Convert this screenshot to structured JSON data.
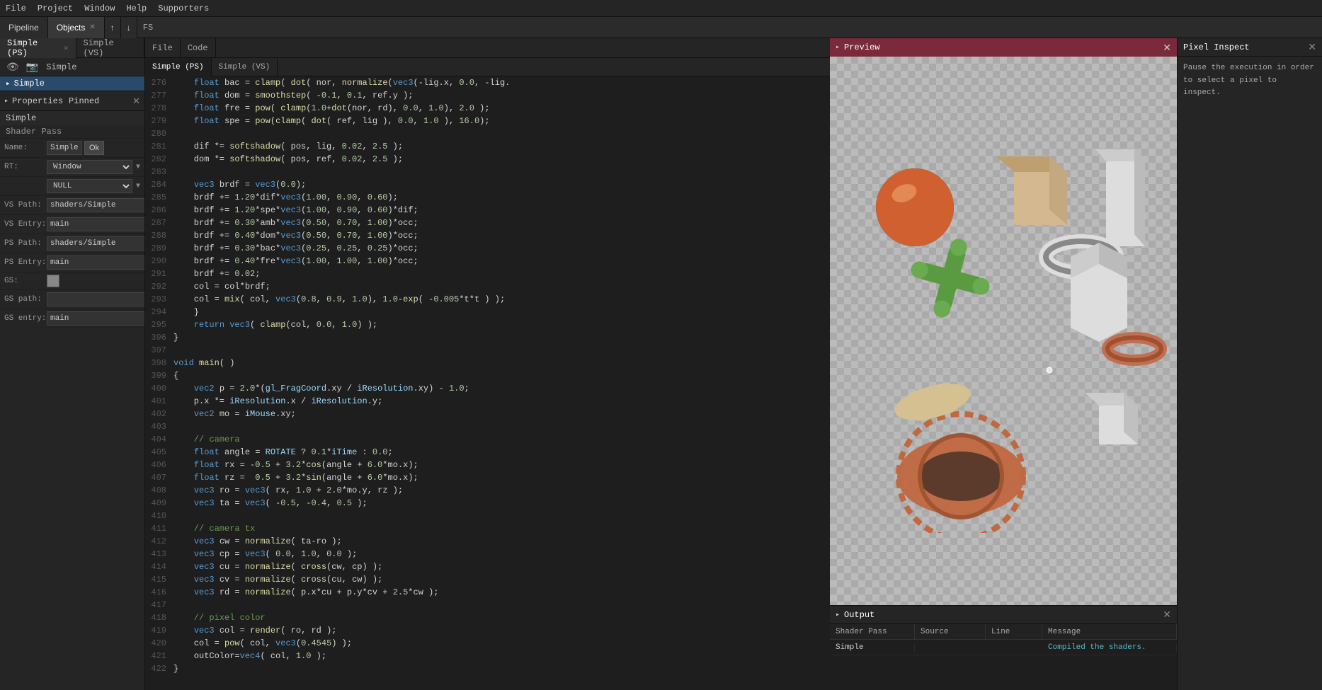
{
  "menuBar": {
    "items": [
      "File",
      "Project",
      "Window",
      "Help",
      "Supporters"
    ]
  },
  "toolbar": {
    "tabs": [
      {
        "label": "Pipeline",
        "active": false
      },
      {
        "label": "Objects",
        "active": true,
        "closable": true
      }
    ],
    "arrows": [
      "↑",
      "↓"
    ],
    "fsLabel": "FS"
  },
  "leftPanel": {
    "tabs": [
      {
        "label": "Simple (PS)",
        "active": true,
        "modified": true,
        "closable": true
      },
      {
        "label": "Simple (VS)",
        "active": false,
        "closable": false
      }
    ],
    "treeItems": [
      {
        "label": "Simple",
        "selected": true,
        "indent": 0
      }
    ]
  },
  "propertiesPanel": {
    "headerLabel": "Properties",
    "pinnedLabel": "Pinned",
    "sectionLabel": "Simple",
    "subsectionLabel": "Shader Pass",
    "fields": {
      "name": {
        "label": "Name:",
        "value": "Simple",
        "btnLabel": "Ok"
      },
      "rt": {
        "label": "RT:",
        "value": "Window",
        "dropdown": true
      },
      "rtNull": {
        "label": "",
        "value": "NULL",
        "dropdown": true
      },
      "vsPath": {
        "label": "VS Path:",
        "value": "shaders/Simple",
        "browseable": true
      },
      "vsEntry": {
        "label": "VS Entry:",
        "value": "main"
      },
      "psPath": {
        "label": "PS Path:",
        "value": "shaders/Simple",
        "browseable": true
      },
      "psEntry": {
        "label": "PS Entry:",
        "value": "main"
      },
      "gs": {
        "label": "GS:",
        "value": ""
      },
      "gsPath": {
        "label": "GS path:",
        "value": "",
        "browseable": true
      },
      "gsEntry": {
        "label": "GS entry:",
        "value": "main"
      }
    }
  },
  "codeEditor": {
    "codeTabs": [
      {
        "label": "File",
        "active": false
      },
      {
        "label": "Code",
        "active": false
      }
    ],
    "fileTabs": [
      {
        "label": "Simple (PS)",
        "active": true,
        "modified": true
      },
      {
        "label": "Simple (VS)",
        "active": false
      }
    ],
    "lines": [
      {
        "num": 276,
        "code": "    float bac = clamp( dot( nor, normalize(vec3(-lig.x, 0.0, -lig."
      },
      {
        "num": 277,
        "code": "    float dom = smoothstep( -0.1, 0.1, ref.y );"
      },
      {
        "num": 278,
        "code": "    float fre = pow( clamp(1.0+dot(nor, rd), 0.0, 1.0), 2.0 );"
      },
      {
        "num": 279,
        "code": "    float spe = pow(clamp( dot( ref, lig ), 0.0, 1.0 ), 16.0);"
      },
      {
        "num": 280,
        "code": ""
      },
      {
        "num": 281,
        "code": "    dif *= softshadow( pos, lig, 0.02, 2.5 );"
      },
      {
        "num": 282,
        "code": "    dom *= softshadow( pos, ref, 0.02, 2.5 );"
      },
      {
        "num": 283,
        "code": ""
      },
      {
        "num": 284,
        "code": "    vec3 brdf = vec3(0.0);"
      },
      {
        "num": 285,
        "code": "    brdf += 1.20*dif*vec3(1.00, 0.90, 0.60);"
      },
      {
        "num": 286,
        "code": "    brdf += 1.20*spe*vec3(1.00, 0.90, 0.60)*dif;"
      },
      {
        "num": 287,
        "code": "    brdf += 0.30*amb*vec3(0.50, 0.70, 1.00)*occ;"
      },
      {
        "num": 288,
        "code": "    brdf += 0.40*dom*vec3(0.50, 0.70, 1.00)*occ;"
      },
      {
        "num": 289,
        "code": "    brdf += 0.30*bac*vec3(0.25, 0.25, 0.25)*occ;"
      },
      {
        "num": 290,
        "code": "    brdf += 0.40*fre*vec3(1.00, 1.00, 1.00)*occ;"
      },
      {
        "num": 291,
        "code": "    brdf += 0.02;"
      },
      {
        "num": 292,
        "code": "    col = col*brdf;"
      },
      {
        "num": 293,
        "code": "    col = mix( col, vec3(0.8, 0.9, 1.0), 1.0-exp( -0.005*t*t ) );"
      },
      {
        "num": 294,
        "code": "    }"
      },
      {
        "num": 295,
        "code": "    return vec3( clamp(col, 0.0, 1.0) );"
      },
      {
        "num": 396,
        "code": "}"
      },
      {
        "num": 397,
        "code": ""
      },
      {
        "num": 398,
        "code": "void main( )"
      },
      {
        "num": 399,
        "code": "{"
      },
      {
        "num": 400,
        "code": "    vec2 p = 2.0*(gl_FragCoord.xy / iResolution.xy) - 1.0;"
      },
      {
        "num": 401,
        "code": "    p.x *= iResolution.x / iResolution.y;"
      },
      {
        "num": 402,
        "code": "    vec2 mo = iMouse.xy;"
      },
      {
        "num": 403,
        "code": ""
      },
      {
        "num": 404,
        "code": "    // camera"
      },
      {
        "num": 405,
        "code": "    float angle = ROTATE ? 0.1*iTime : 0.0;"
      },
      {
        "num": 406,
        "code": "    float rx = -0.5 + 3.2*cos(angle + 6.0*mo.x);"
      },
      {
        "num": 407,
        "code": "    float rz =  0.5 + 3.2*sin(angle + 6.0*mo.x);"
      },
      {
        "num": 408,
        "code": "    vec3 ro = vec3( rx, 1.0 + 2.0*mo.y, rz );"
      },
      {
        "num": 409,
        "code": "    vec3 ta = vec3( -0.5, -0.4, 0.5 );"
      },
      {
        "num": 410,
        "code": ""
      },
      {
        "num": 411,
        "code": "    // camera tx"
      },
      {
        "num": 412,
        "code": "    vec3 cw = normalize( ta-ro );"
      },
      {
        "num": 413,
        "code": "    vec3 cp = vec3( 0.0, 1.0, 0.0 );"
      },
      {
        "num": 414,
        "code": "    vec3 cu = normalize( cross(cw, cp) );"
      },
      {
        "num": 415,
        "code": "    vec3 cv = normalize( cross(cu, cw) );"
      },
      {
        "num": 416,
        "code": "    vec3 rd = normalize( p.x*cu + p.y*cv + 2.5*cw );"
      },
      {
        "num": 417,
        "code": ""
      },
      {
        "num": 418,
        "code": "    // pixel color"
      },
      {
        "num": 419,
        "code": "    vec3 col = render( ro, rd );"
      },
      {
        "num": 420,
        "code": "    col = pow( col, vec3(0.4545) );"
      },
      {
        "num": 421,
        "code": "    outColor=vec4( col, 1.0 );"
      },
      {
        "num": 422,
        "code": "}"
      }
    ]
  },
  "previewPanel": {
    "headerLabel": "Preview"
  },
  "outputPanel": {
    "headerLabel": "Output",
    "columns": [
      "Shader Pass",
      "Source",
      "Line",
      "Message"
    ],
    "rows": [
      {
        "shaderPass": "Simple",
        "source": "",
        "line": "",
        "message": "Compiled the shaders."
      }
    ]
  },
  "pixelInspect": {
    "headerLabel": "Pixel Inspect",
    "body": "Pause the execution in order to select a pixel to inspect."
  }
}
